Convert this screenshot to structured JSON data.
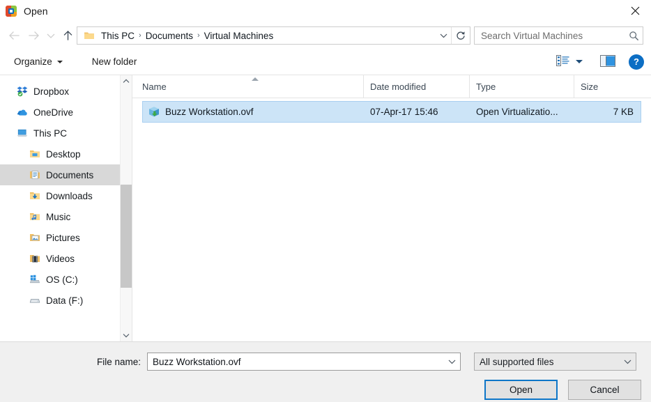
{
  "window": {
    "title": "Open",
    "app_icon": "vmware-icon",
    "close_label": "✕"
  },
  "navigation": {
    "back_icon": "arrow-left-icon",
    "forward_icon": "arrow-right-icon",
    "recent_icon": "chevron-down-icon",
    "up_icon": "arrow-up-icon",
    "address_folder_icon": "folder-icon",
    "breadcrumbs": [
      "This PC",
      "Documents",
      "Virtual Machines"
    ],
    "separator": "›",
    "address_dropdown_icon": "chevron-down-icon",
    "refresh_icon": "refresh-icon"
  },
  "search": {
    "placeholder": "Search Virtual Machines",
    "icon": "search-icon"
  },
  "commandbar": {
    "organize_label": "Organize",
    "new_folder_label": "New folder",
    "view_icon": "list-view-icon",
    "view_dropdown_icon": "chevron-down-icon",
    "preview_pane_icon": "preview-pane-icon",
    "help_label": "?",
    "help_icon": "help-icon"
  },
  "sidebar": {
    "items": [
      {
        "label": "Dropbox",
        "icon": "dropbox-icon",
        "level": 0,
        "selected": false
      },
      {
        "label": "OneDrive",
        "icon": "onedrive-icon",
        "level": 0,
        "selected": false
      },
      {
        "label": "This PC",
        "icon": "this-pc-icon",
        "level": 0,
        "selected": false
      },
      {
        "label": "Desktop",
        "icon": "desktop-icon",
        "level": 1,
        "selected": false
      },
      {
        "label": "Documents",
        "icon": "documents-icon",
        "level": 1,
        "selected": true
      },
      {
        "label": "Downloads",
        "icon": "downloads-icon",
        "level": 1,
        "selected": false
      },
      {
        "label": "Music",
        "icon": "music-icon",
        "level": 1,
        "selected": false
      },
      {
        "label": "Pictures",
        "icon": "pictures-icon",
        "level": 1,
        "selected": false
      },
      {
        "label": "Videos",
        "icon": "videos-icon",
        "level": 1,
        "selected": false
      },
      {
        "label": "OS (C:)",
        "icon": "windows-drive-icon",
        "level": 1,
        "selected": false
      },
      {
        "label": "Data (F:)",
        "icon": "drive-icon",
        "level": 1,
        "selected": false
      }
    ],
    "scroll_up_icon": "chevron-up-icon",
    "scroll_down_icon": "chevron-down-icon"
  },
  "filelist": {
    "columns": [
      {
        "label": "Name",
        "sorted": "asc"
      },
      {
        "label": "Date modified",
        "sorted": ""
      },
      {
        "label": "Type",
        "sorted": ""
      },
      {
        "label": "Size",
        "sorted": ""
      }
    ],
    "rows": [
      {
        "name": "Buzz Workstation.ovf",
        "date_modified": "07-Apr-17 15:46",
        "type": "Open Virtualizatio...",
        "size": "7 KB",
        "icon": "ovf-file-icon",
        "selected": true
      }
    ]
  },
  "footer": {
    "file_name_label": "File name:",
    "file_name_value": "Buzz Workstation.ovf",
    "file_name_dropdown_icon": "chevron-down-icon",
    "filter_value": "All supported files",
    "filter_dropdown_icon": "chevron-down-icon",
    "open_label": "Open",
    "cancel_label": "Cancel"
  },
  "colors": {
    "selection_blue": "#cce4f7",
    "selection_border": "#a9cff0",
    "focus_blue": "#0d76c8",
    "sidebar_selected": "#d8d8d8",
    "footer_bg": "#f0f0f0"
  }
}
